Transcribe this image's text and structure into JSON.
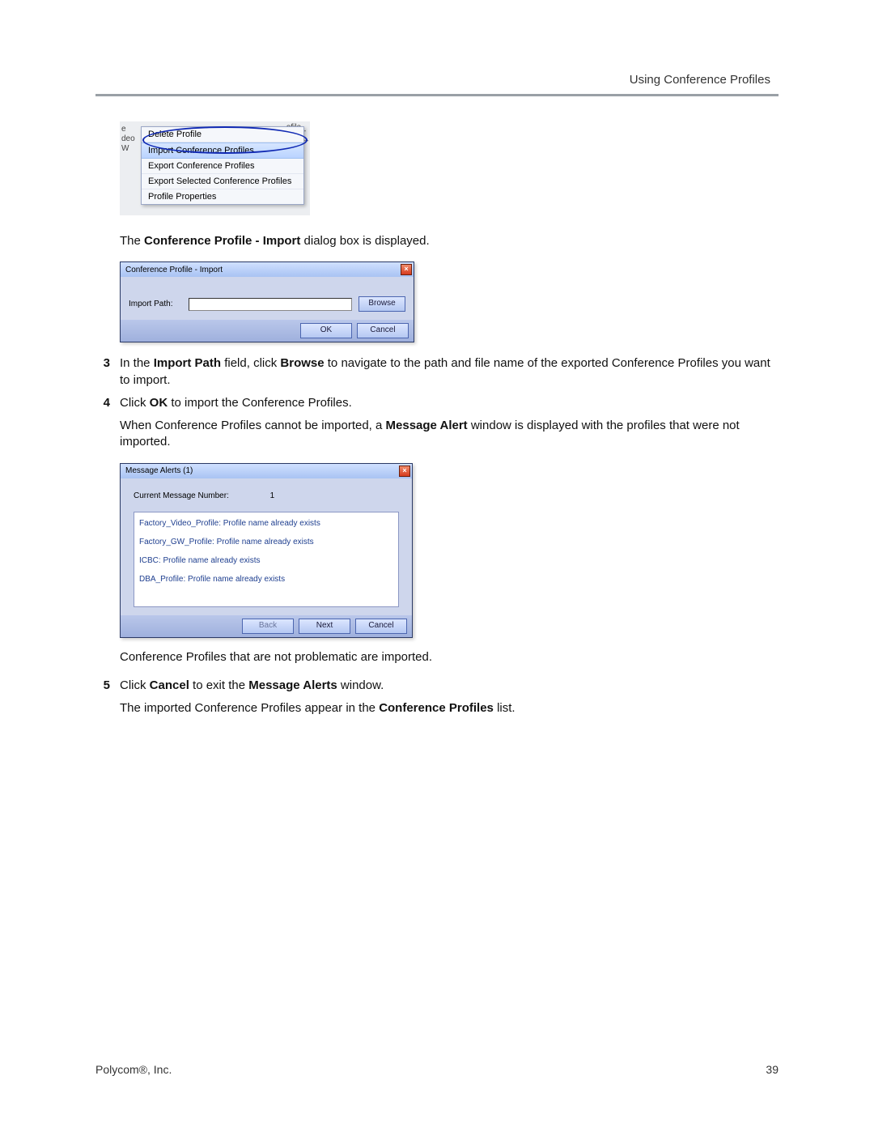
{
  "header": {
    "right": "Using Conference Profiles"
  },
  "context_menu": {
    "bg_fragments_left": [
      "e",
      "deo",
      "W"
    ],
    "bg_fragments_right": [
      "ofile_",
      "ctory_",
      "tory_"
    ],
    "items": [
      "Delete Profile",
      "Import Conference Profiles",
      "Export Conference Profiles",
      "Export Selected Conference Profiles",
      "Profile Properties"
    ]
  },
  "sentence1_pre": "The ",
  "sentence1_bold": "Conference Profile - Import",
  "sentence1_post": " dialog box is displayed.",
  "import_dialog": {
    "title": "Conference Profile - Import",
    "label": "Import Path:",
    "browse": "Browse",
    "ok": "OK",
    "cancel": "Cancel"
  },
  "step3": {
    "num": "3",
    "t1": "In the ",
    "b1": "Import Path",
    "t2": " field, click ",
    "b2": "Browse",
    "t3": " to navigate to the path and file name of the exported Conference Profiles you want to import."
  },
  "step4": {
    "num": "4",
    "t1": "Click ",
    "b1": "OK",
    "t2": " to import the Conference Profiles.",
    "para2a": "When Conference Profiles cannot be imported, a ",
    "para2b": "Message Alert",
    "para2c": " window is displayed with the profiles that were not imported."
  },
  "message_alerts": {
    "title": "Message Alerts (1)",
    "row1_label": "Current Message Number:",
    "row1_value": "1",
    "items": [
      "Factory_Video_Profile: Profile name already exists",
      "Factory_GW_Profile: Profile name already exists",
      "ICBC: Profile name already exists",
      "DBA_Profile: Profile name already exists"
    ],
    "back": "Back",
    "next": "Next",
    "cancel": "Cancel"
  },
  "after_ma": "Conference Profiles that are not problematic are imported.",
  "step5": {
    "num": "5",
    "t1": "Click ",
    "b1": "Cancel",
    "t2": " to exit the ",
    "b2": "Message Alerts",
    "t3": " window.",
    "para2a": "The imported Conference Profiles appear in the ",
    "para2b": "Conference Profiles",
    "para2c": " list."
  },
  "footer": {
    "left": "Polycom®, Inc.",
    "right": "39"
  }
}
